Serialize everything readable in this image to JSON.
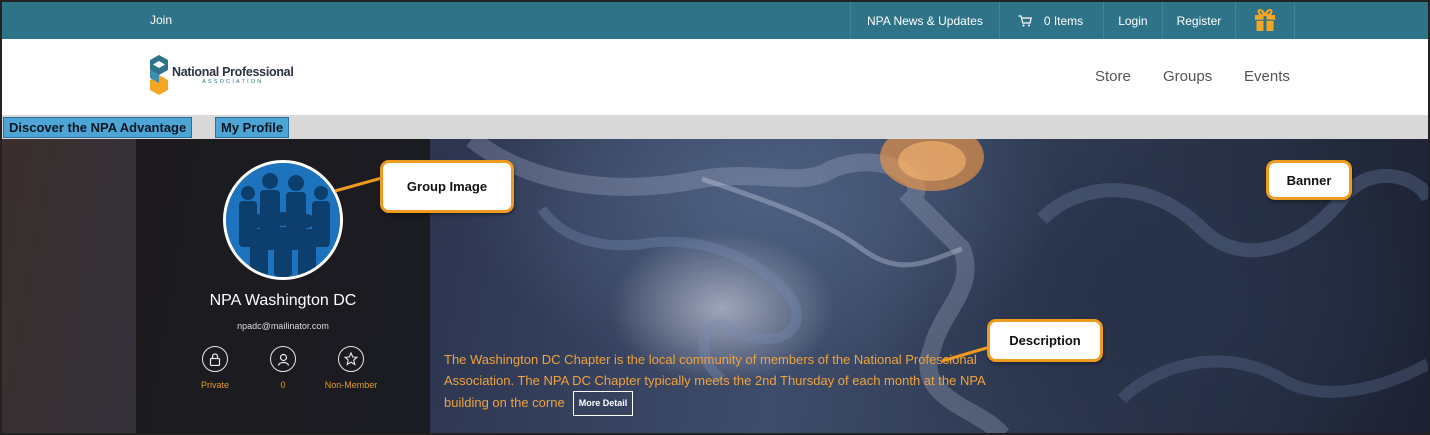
{
  "topbar": {
    "join": "Join",
    "news": "NPA News & Updates",
    "cart": "0 Items",
    "login": "Login",
    "register": "Register"
  },
  "header": {
    "logo_name": "National Professional",
    "logo_sub": "ASSOCIATION",
    "nav": [
      "Store",
      "Groups",
      "Events"
    ]
  },
  "tabs": [
    "Discover the NPA Advantage",
    "My Profile"
  ],
  "group": {
    "name": "NPA Washington DC",
    "email": "npadc@mailinator.com",
    "stats": [
      {
        "icon": "lock-icon",
        "label": "Private"
      },
      {
        "icon": "user-icon",
        "label": "0"
      },
      {
        "icon": "star-icon",
        "label": "Non-Member"
      }
    ],
    "description": "The Washington DC Chapter is the local community of members of the National Professional Association. The NPA DC Chapter typically meets the 2nd Thursday of each month at the NPA building on the corne",
    "more_label": "More Detail"
  },
  "callouts": {
    "group_image": "Group Image",
    "banner": "Banner",
    "description": "Description"
  },
  "colors": {
    "topbar": "#2f7389",
    "callout_border": "#f09b1d",
    "tab": "#4da5d6",
    "description_text": "#f0a23c"
  }
}
